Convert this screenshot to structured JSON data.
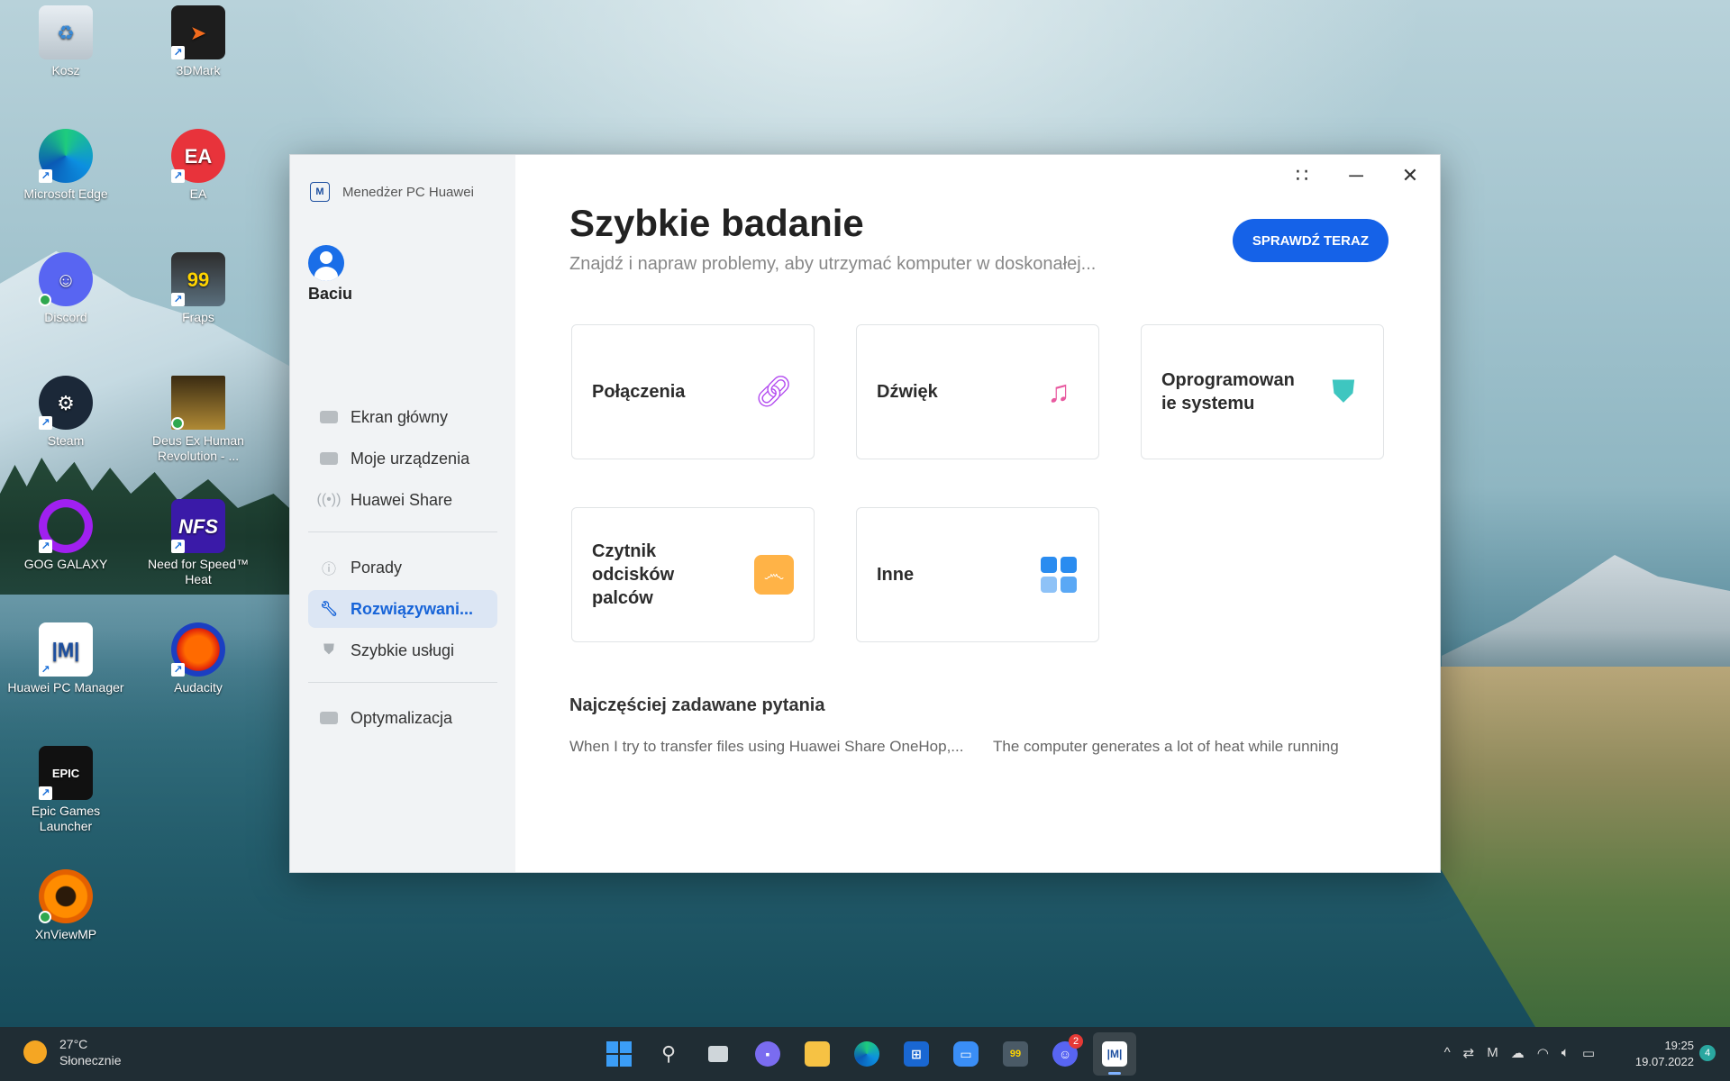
{
  "desktop": {
    "icons": [
      {
        "label": "Kosz"
      },
      {
        "label": "3DMark"
      },
      {
        "label": "Microsoft Edge"
      },
      {
        "label": "EA"
      },
      {
        "label": "Discord"
      },
      {
        "label": "Fraps"
      },
      {
        "label": "Steam"
      },
      {
        "label": "Deus Ex Human Revolution - ..."
      },
      {
        "label": "GOG GALAXY"
      },
      {
        "label": "Need for Speed™ Heat"
      },
      {
        "label": "Huawei PC Manager"
      },
      {
        "label": "Audacity"
      },
      {
        "label": "Epic Games Launcher"
      },
      {
        "label": "XnViewMP"
      }
    ]
  },
  "app": {
    "title": "Menedżer PC Huawei",
    "user": "Baciu",
    "nav": {
      "group1": [
        "Ekran główny",
        "Moje urządzenia",
        "Huawei Share"
      ],
      "group2": [
        "Porady",
        "Rozwiązywani...",
        "Szybkie usługi"
      ],
      "group3": [
        "Optymalizacja"
      ]
    },
    "main": {
      "title": "Szybkie badanie",
      "subtitle": "Znajdź i napraw problemy, aby utrzymać komputer w doskonałej...",
      "check_button": "SPRAWDŹ TERAZ",
      "cards": [
        "Połączenia",
        "Dźwięk",
        "Oprogramowan ie systemu",
        "Czytnik odcisków palców",
        "Inne"
      ],
      "faq_title": "Najczęściej zadawane pytania",
      "faq_links": [
        "When I try to transfer files using Huawei Share OneHop,...",
        "The computer generates a lot of heat while running"
      ]
    }
  },
  "taskbar": {
    "weather_temp": "27°C",
    "weather_desc": "Słonecznie",
    "discord_badge": "2",
    "time": "19:25",
    "date": "19.07.2022",
    "notifications": "4"
  },
  "colors": {
    "accent": "#1562e8",
    "active_nav_bg": "#dce6f4"
  }
}
